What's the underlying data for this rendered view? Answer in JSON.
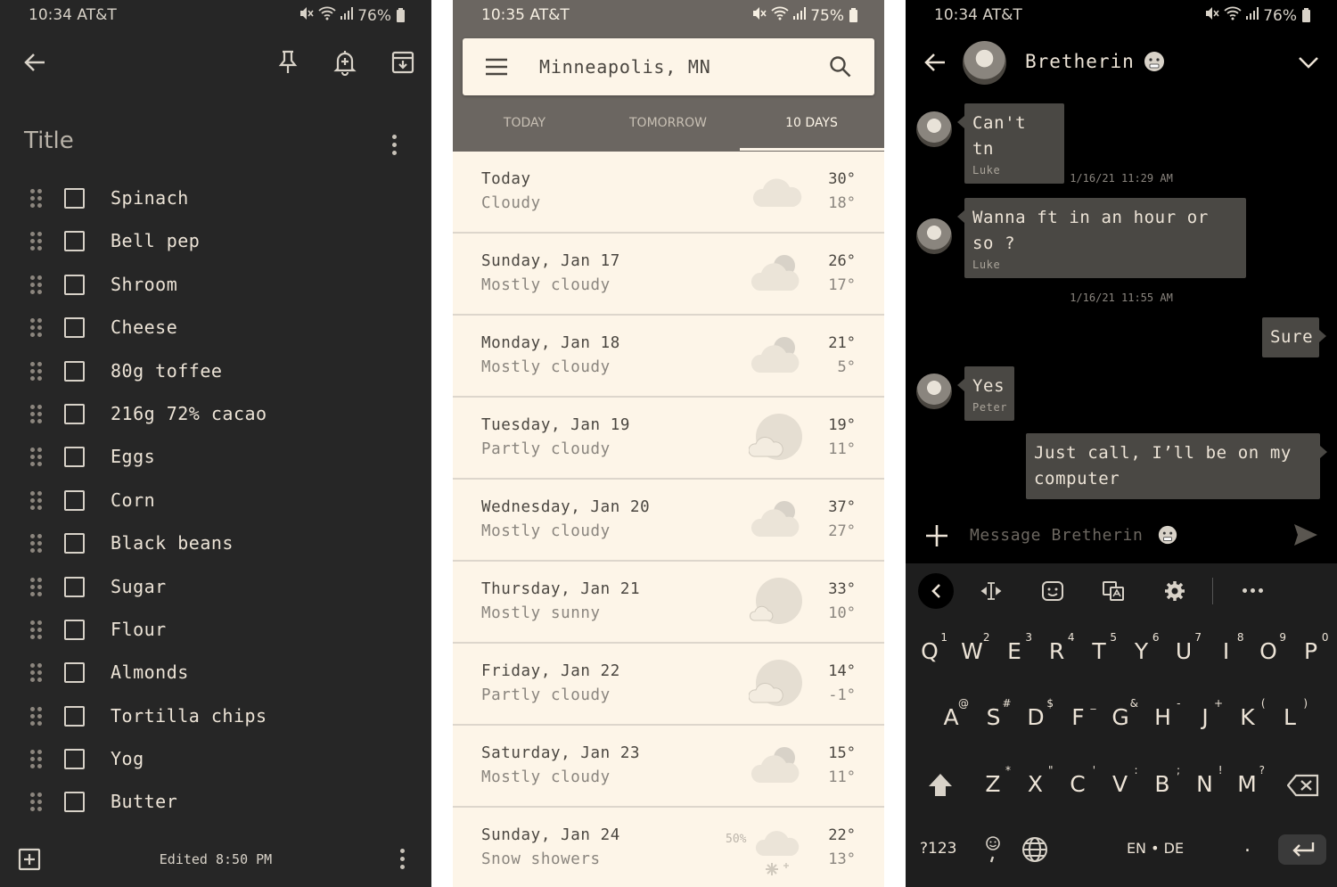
{
  "notes_app": {
    "status": {
      "time": "10:34 AT&T",
      "battery": "76%"
    },
    "title": "Title",
    "items": [
      "Spinach",
      "Bell pep",
      "Shroom",
      "Cheese",
      "80g toffee",
      "216g 72% cacao",
      "Eggs",
      "Corn",
      "Black beans",
      "Sugar",
      "Flour",
      "Almonds",
      "Tortilla chips",
      "Yog",
      "Butter"
    ],
    "edited": "Edited 8:50 PM",
    "colors": {
      "background": "#262626",
      "text": "#ece3d6"
    }
  },
  "weather_app": {
    "status": {
      "time": "10:35 AT&T",
      "battery": "75%"
    },
    "location": "Minneapolis, MN",
    "tabs": [
      {
        "label": "TODAY"
      },
      {
        "label": "TOMORROW"
      },
      {
        "label": "10 DAYS"
      }
    ],
    "active_tab": "10 DAYS",
    "days": [
      {
        "name": "Today",
        "condition": "Cloudy",
        "high": "30°",
        "low": "18°",
        "icon": "cloud-icon",
        "precip": ""
      },
      {
        "name": "Sunday, Jan 17",
        "condition": "Mostly cloudy",
        "high": "26°",
        "low": "17°",
        "icon": "mostly-cloudy-icon",
        "precip": ""
      },
      {
        "name": "Monday, Jan 18",
        "condition": "Mostly cloudy",
        "high": "21°",
        "low": "5°",
        "icon": "mostly-cloudy-icon",
        "precip": ""
      },
      {
        "name": "Tuesday, Jan 19",
        "condition": "Partly cloudy",
        "high": "19°",
        "low": "11°",
        "icon": "partly-cloudy-icon",
        "precip": ""
      },
      {
        "name": "Wednesday, Jan 20",
        "condition": "Mostly cloudy",
        "high": "37°",
        "low": "27°",
        "icon": "mostly-cloudy-icon",
        "precip": ""
      },
      {
        "name": "Thursday, Jan 21",
        "condition": "Mostly sunny",
        "high": "33°",
        "low": "10°",
        "icon": "mostly-sunny-icon",
        "precip": ""
      },
      {
        "name": "Friday, Jan 22",
        "condition": "Partly cloudy",
        "high": "14°",
        "low": "-1°",
        "icon": "partly-cloudy-icon",
        "precip": ""
      },
      {
        "name": "Saturday, Jan 23",
        "condition": "Mostly cloudy",
        "high": "15°",
        "low": "11°",
        "icon": "mostly-cloudy-icon",
        "precip": ""
      },
      {
        "name": "Sunday, Jan 24",
        "condition": "Snow showers",
        "high": "22°",
        "low": "13°",
        "icon": "snow-showers-icon",
        "precip": "50%"
      }
    ],
    "colors": {
      "header": "#6b6661",
      "background": "#fdf5e8"
    }
  },
  "messages_app": {
    "status": {
      "time": "10:34 AT&T",
      "battery": "76%"
    },
    "contact": "Bretherin",
    "messages": [
      {
        "text": "Can't tn",
        "sender": "Luke"
      },
      {
        "timestamp": "1/16/21 11:29 AM"
      },
      {
        "line1": "Wanna ft in an hour or",
        "line2": "so ?",
        "sender": "Luke"
      },
      {
        "timestamp": "1/16/21 11:55 AM"
      },
      {
        "text": "Sure"
      },
      {
        "text": "Yes",
        "sender": "Peter"
      },
      {
        "line1": "Just call, I’ll be on my",
        "line2": "computer"
      }
    ],
    "composer_placeholder": "Message Bretherin",
    "keyboard": {
      "row1": [
        {
          "k": "Q",
          "s": "1"
        },
        {
          "k": "W",
          "s": "2"
        },
        {
          "k": "E",
          "s": "3"
        },
        {
          "k": "R",
          "s": "4"
        },
        {
          "k": "T",
          "s": "5"
        },
        {
          "k": "Y",
          "s": "6"
        },
        {
          "k": "U",
          "s": "7"
        },
        {
          "k": "I",
          "s": "8"
        },
        {
          "k": "O",
          "s": "9"
        },
        {
          "k": "P",
          "s": "0"
        }
      ],
      "row2": [
        {
          "k": "A",
          "s": "@"
        },
        {
          "k": "S",
          "s": "#"
        },
        {
          "k": "D",
          "s": "$"
        },
        {
          "k": "F",
          "s": "_"
        },
        {
          "k": "G",
          "s": "&"
        },
        {
          "k": "H",
          "s": "-"
        },
        {
          "k": "J",
          "s": "+"
        },
        {
          "k": "K",
          "s": "("
        },
        {
          "k": "L",
          "s": ")"
        }
      ],
      "row3": [
        {
          "k": "Z",
          "s": "*"
        },
        {
          "k": "X",
          "s": "\""
        },
        {
          "k": "C",
          "s": "'"
        },
        {
          "k": "V",
          "s": ":"
        },
        {
          "k": "B",
          "s": ";"
        },
        {
          "k": "N",
          "s": "!"
        },
        {
          "k": "M",
          "s": "?"
        }
      ],
      "symbols_key": "?123",
      "space_label": "EN • DE",
      "period": "."
    }
  }
}
